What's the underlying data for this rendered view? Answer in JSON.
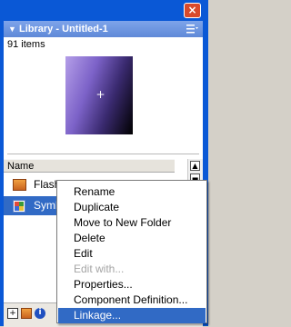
{
  "panel": {
    "title": "Library - Untitled-1",
    "item_count": "91 items",
    "column_header": "Name"
  },
  "items": [
    {
      "label": "Flash UI Components",
      "icon": "folder-icon"
    },
    {
      "label": "Symbol 1",
      "icon": "symbol-icon",
      "selected": true
    }
  ],
  "context_menu": {
    "items": [
      {
        "label": "Rename",
        "enabled": true
      },
      {
        "label": "Duplicate",
        "enabled": true
      },
      {
        "label": "Move to New Folder",
        "enabled": true
      },
      {
        "label": "Delete",
        "enabled": true
      },
      {
        "label": "Edit",
        "enabled": true
      },
      {
        "label": "Edit with...",
        "enabled": false
      },
      {
        "label": "Properties...",
        "enabled": true
      },
      {
        "label": "Component Definition...",
        "enabled": true
      },
      {
        "label": "Linkage...",
        "enabled": true,
        "highlighted": true
      }
    ]
  },
  "colors": {
    "titlebar": "#0a58d6",
    "selection": "#316ac5",
    "panel_header": "#6e96e0"
  }
}
